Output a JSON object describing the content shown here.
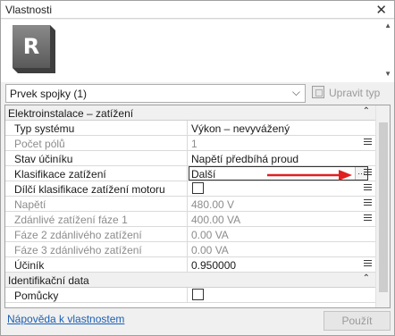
{
  "window": {
    "title": "Vlastnosti",
    "close_glyph": "✕"
  },
  "type_selector": {
    "selected": "Prvek spojky (1)",
    "edit_type_label": "Upravit typ"
  },
  "groups": [
    {
      "label": "Elektroinstalace – zatížení",
      "rows": [
        {
          "key": "Typ systému",
          "value": "Výkon – nevyvážený",
          "disabled": false
        },
        {
          "key": "Počet pólů",
          "value": "1",
          "disabled": true
        },
        {
          "key": "Stav účiníku",
          "value": "Napětí předbíhá proud",
          "disabled": false
        },
        {
          "key": "Klasifikace zatížení",
          "value": "Další",
          "disabled": false,
          "editing": true
        },
        {
          "key": "Dílčí klasifikace zatížení motoru",
          "value": "",
          "checkbox": true,
          "checked": false,
          "disabled": false
        },
        {
          "key": "Napětí",
          "value": "480.00 V",
          "disabled": true
        },
        {
          "key": "Zdánlivé zatížení fáze 1",
          "value": "400.00 VA",
          "disabled": true
        },
        {
          "key": "Fáze 2 zdánlivého zatížení",
          "value": "0.00 VA",
          "disabled": true
        },
        {
          "key": "Fáze 3 zdánlivého zatížení",
          "value": "0.00 VA",
          "disabled": true
        },
        {
          "key": "Účiník",
          "value": "0.950000",
          "disabled": false
        }
      ]
    },
    {
      "label": "Identifikační data",
      "rows": [
        {
          "key": "Pomůcky",
          "value": "",
          "checkbox": true,
          "checked": false,
          "disabled": false
        }
      ]
    }
  ],
  "footer": {
    "help_link": "Nápověda k vlastnostem",
    "apply_label": "Použít"
  },
  "icons": {
    "family_icon": "revit-family-icon",
    "collapse": "collapse-icon",
    "browse": "browse-icon"
  },
  "colors": {
    "link": "#1a5fb4",
    "annotation_arrow": "#e02020"
  }
}
